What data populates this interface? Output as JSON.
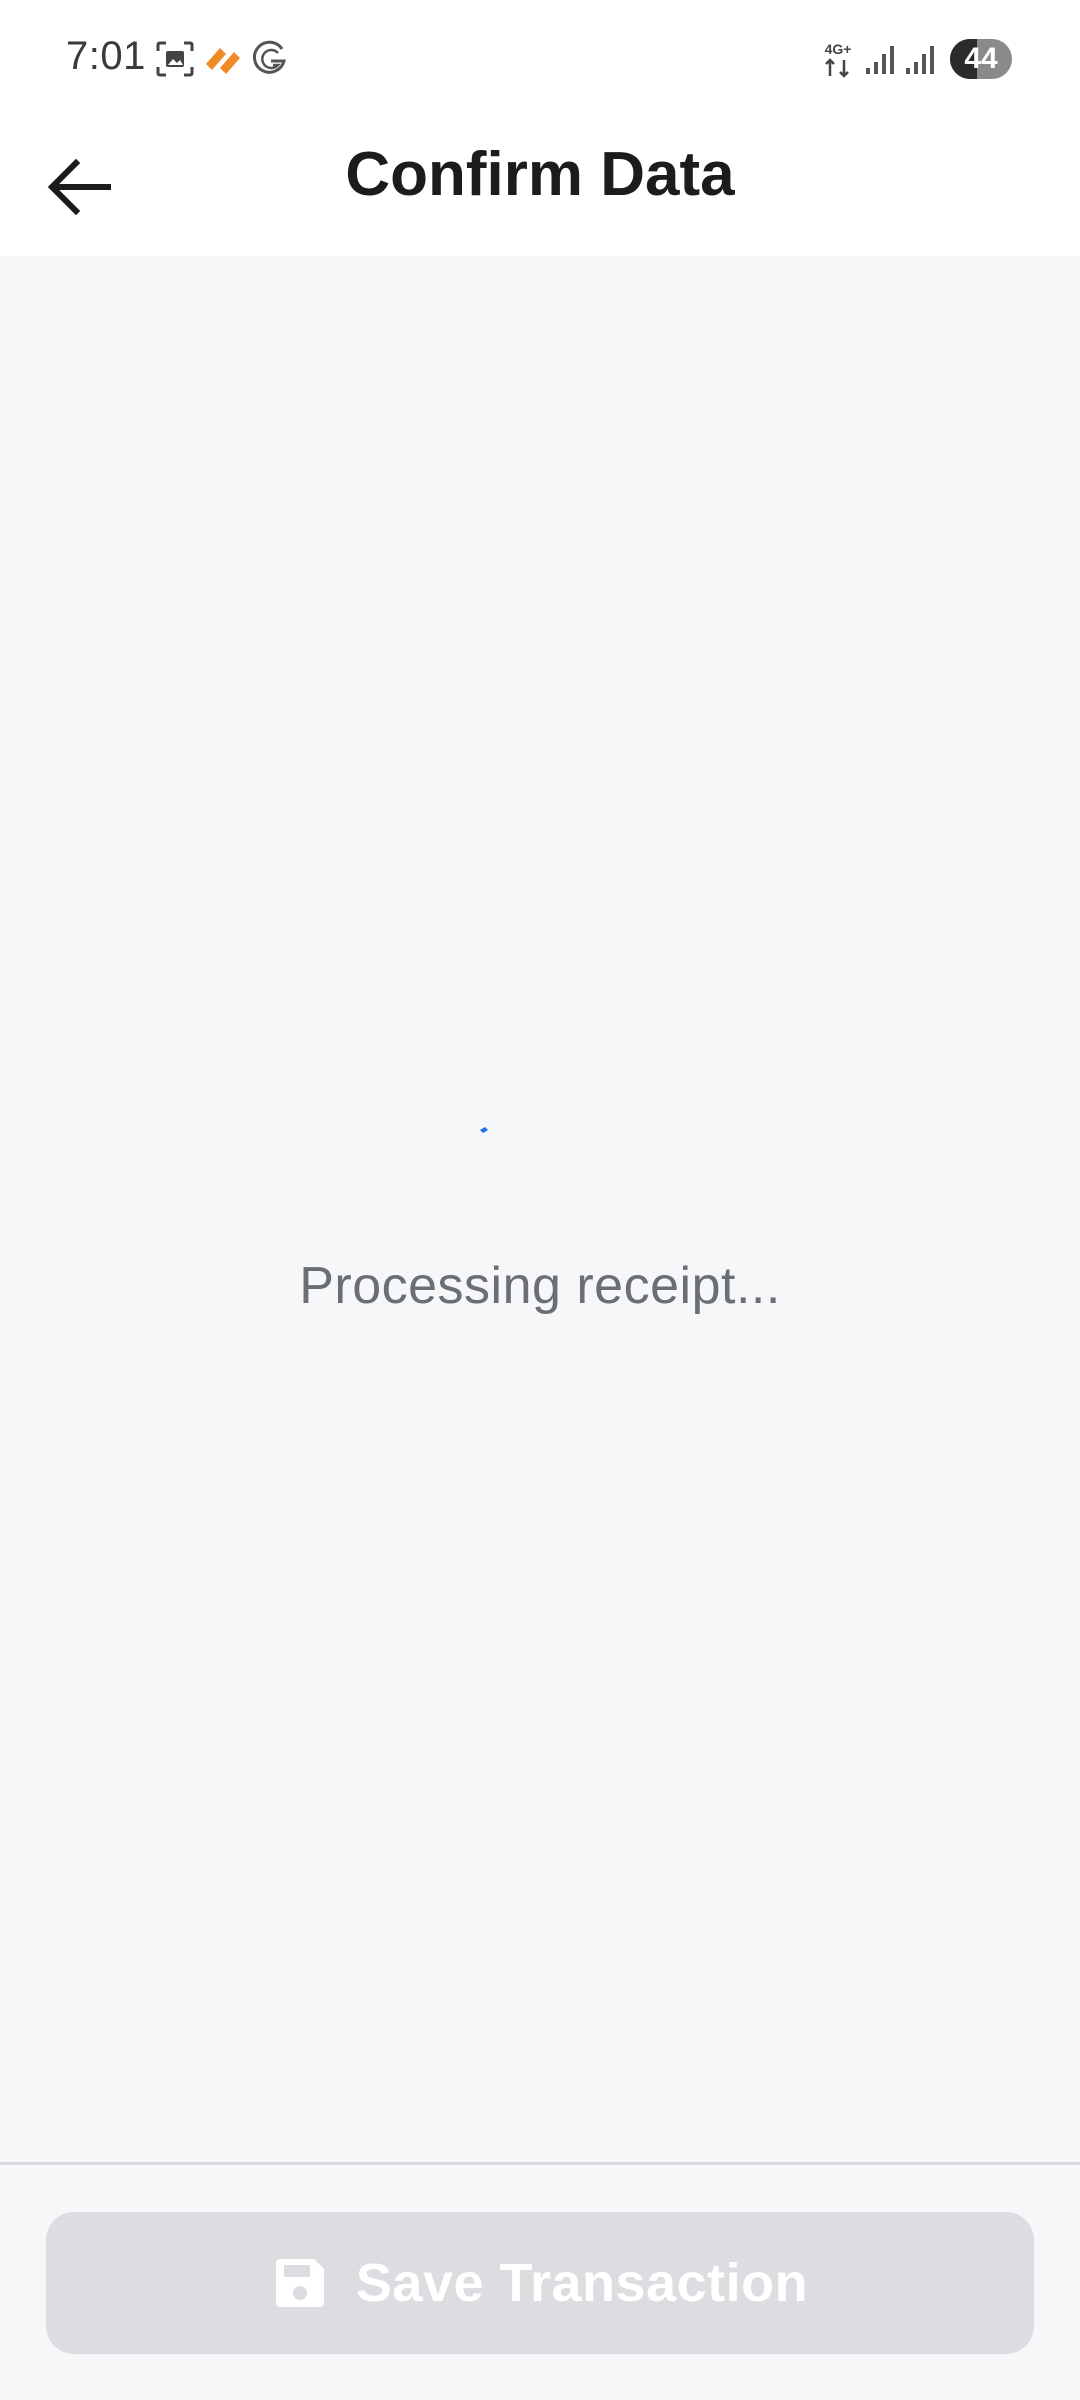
{
  "status_bar": {
    "time": "7:01",
    "network_type": "4G+",
    "battery_level": "44",
    "battery_fraction": 0.44,
    "icons": [
      "screenshot-icon",
      "app-notification-icon",
      "g-app-icon",
      "network-4g-icon",
      "signal-icon",
      "signal-icon",
      "battery-icon"
    ],
    "accent_orange": "#f08a24"
  },
  "header": {
    "title": "Confirm Data",
    "back_icon": "arrow-left-icon"
  },
  "main": {
    "status_text": "Processing receipt...",
    "spinner_color": "#1a73e8"
  },
  "footer": {
    "save_label": "Save Transaction",
    "save_icon": "floppy-disk-icon",
    "save_enabled": false
  }
}
